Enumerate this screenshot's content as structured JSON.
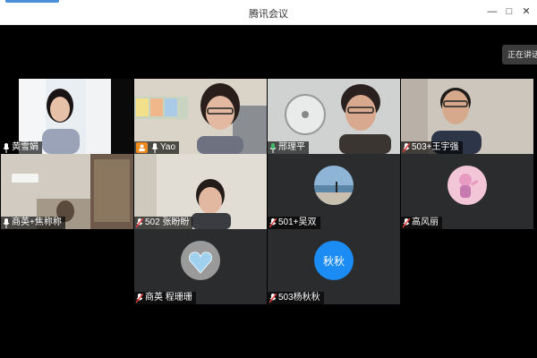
{
  "window": {
    "title": "腾讯会议",
    "minimize_glyph": "—",
    "maximize_glyph": "□",
    "close_glyph": "✕"
  },
  "speaking_indicator": "正在讲话",
  "participants": [
    {
      "name": "黄雪娟"
    },
    {
      "name": "Yao"
    },
    {
      "name": "邢理平"
    },
    {
      "name": "503+王宇强"
    },
    {
      "name": "商英+焦称称"
    },
    {
      "name": "502 张盼盼"
    },
    {
      "name": "501+吴双"
    },
    {
      "name": "高风丽"
    },
    {
      "name": "商英 程珊珊"
    },
    {
      "name": "503杨秋秋",
      "avatar_text": "秋秋"
    }
  ],
  "colors": {
    "mic_active": "#3fb86b",
    "mic_muted": "#e23b3b",
    "avatar_blue": "#1c8cf5",
    "camera_badge": "#f08a1c",
    "active_speaker_border": "#3fb86b"
  },
  "icons": {
    "mic": "microphone-icon",
    "mic_muted": "microphone-muted-icon",
    "camera_off": "camera-off-icon"
  }
}
